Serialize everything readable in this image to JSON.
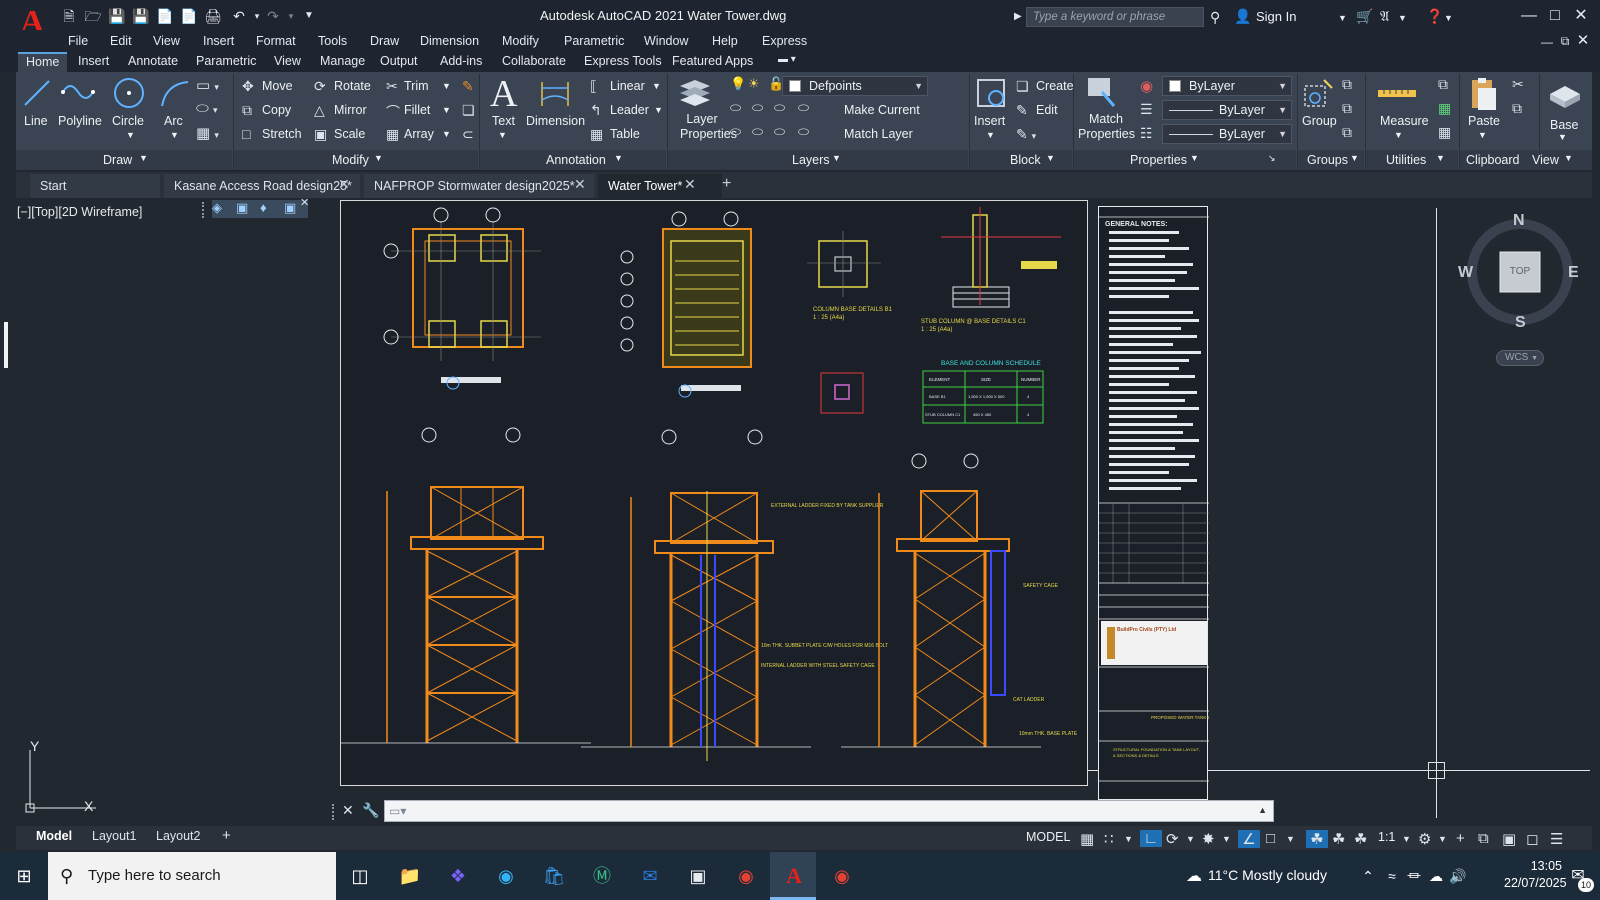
{
  "titlebar": {
    "app_title": "Autodesk AutoCAD 2021   Water Tower.dwg",
    "search_placeholder": "Type a keyword or phrase",
    "sign_in": "Sign In"
  },
  "menu": [
    "File",
    "Edit",
    "View",
    "Insert",
    "Format",
    "Tools",
    "Draw",
    "Dimension",
    "Modify",
    "Parametric",
    "Window",
    "Help",
    "Express"
  ],
  "ribbon_tabs": [
    "Home",
    "Insert",
    "Annotate",
    "Parametric",
    "View",
    "Manage",
    "Output",
    "Add-ins",
    "Collaborate",
    "Express Tools",
    "Featured Apps"
  ],
  "ribbon": {
    "draw": {
      "title": "Draw",
      "line": "Line",
      "polyline": "Polyline",
      "circle": "Circle",
      "arc": "Arc"
    },
    "modify": {
      "title": "Modify",
      "move": "Move",
      "rotate": "Rotate",
      "trim": "Trim",
      "copy": "Copy",
      "mirror": "Mirror",
      "fillet": "Fillet",
      "stretch": "Stretch",
      "scale": "Scale",
      "array": "Array"
    },
    "annotation": {
      "title": "Annotation",
      "text": "Text",
      "dimension": "Dimension",
      "linear": "Linear",
      "leader": "Leader",
      "table": "Table"
    },
    "layers": {
      "title": "Layers",
      "layer_properties": "Layer Properties",
      "current_layer": "Defpoints",
      "make_current": "Make Current",
      "match_layer": "Match Layer"
    },
    "block": {
      "title": "Block",
      "insert": "Insert",
      "create": "Create",
      "edit": "Edit"
    },
    "properties": {
      "title": "Properties",
      "match_properties": "Match Properties",
      "color": "ByLayer",
      "linetype": "ByLayer",
      "lineweight": "ByLayer"
    },
    "groups": {
      "title": "Groups",
      "group": "Group"
    },
    "utilities": {
      "title": "Utilities",
      "measure": "Measure"
    },
    "clipboard": {
      "title": "Clipboard",
      "paste": "Paste"
    },
    "view": {
      "title": "View",
      "base": "Base"
    }
  },
  "doc_tabs": [
    "Start",
    "Kasane Access Road design25*",
    "NAFPROP Stormwater design2025*",
    "Water Tower*"
  ],
  "viewport": {
    "label": "[−][Top][2D Wireframe]",
    "compass": {
      "n": "N",
      "s": "S",
      "e": "E",
      "w": "W",
      "cube": "TOP",
      "wcs": "WCS"
    },
    "ucs": {
      "x": "X",
      "y": "Y"
    }
  },
  "drawing": {
    "notes_title": "GENERAL NOTES:",
    "detail_b1": "COLUMN BASE DETAILS B1",
    "detail_b1_scale": "1 : 25  (A4a)",
    "detail_c1": "STUB COLUMN @ BASE DETAILS C1",
    "detail_c1_scale": "1 : 25  (A4a)",
    "schedule_title": "BASE AND COLUMN SCHEDULE",
    "schedule_headers": [
      "ELEMENT",
      "SIZE",
      "NUMBER"
    ],
    "schedule_rows": [
      [
        "BASE B1",
        "1,500 X 1,500 X 500",
        "4"
      ],
      [
        "STUB COLUMN C1",
        "450 X 450",
        "4"
      ]
    ],
    "grid_letters": [
      "A",
      "B",
      "C",
      "D",
      "E",
      "F",
      "G",
      "H",
      "I"
    ],
    "callouts": [
      "EXTERNAL LADDER FIXED BY TANK SUPPLIER",
      "10m THK. SUBBET PLATE C/W HOLES FOR M16 BOLT",
      "INTERNAL LADDER WITH STEEL SAFETY CAGE",
      "SAFETY CAGE",
      "CAT LADDER",
      "10mm THK. BASE PLATE"
    ],
    "title_block": {
      "company": "BuildPro Civils (PTY) Ltd",
      "project": "PROPOSED WATER TANK STAND",
      "drawing": "STRUCTURAL FOUNDATION & TANK LAYOUT & SECTIONS & DETAILS"
    }
  },
  "statusbar": {
    "layouts": [
      "Model",
      "Layout1",
      "Layout2"
    ],
    "mode": "MODEL",
    "scale": "1:1"
  },
  "taskbar": {
    "search_placeholder": "Type here to search",
    "temperature": "11°C",
    "weather": "Mostly cloudy",
    "time": "13:05",
    "date": "22/07/2025",
    "notifications": "10"
  }
}
